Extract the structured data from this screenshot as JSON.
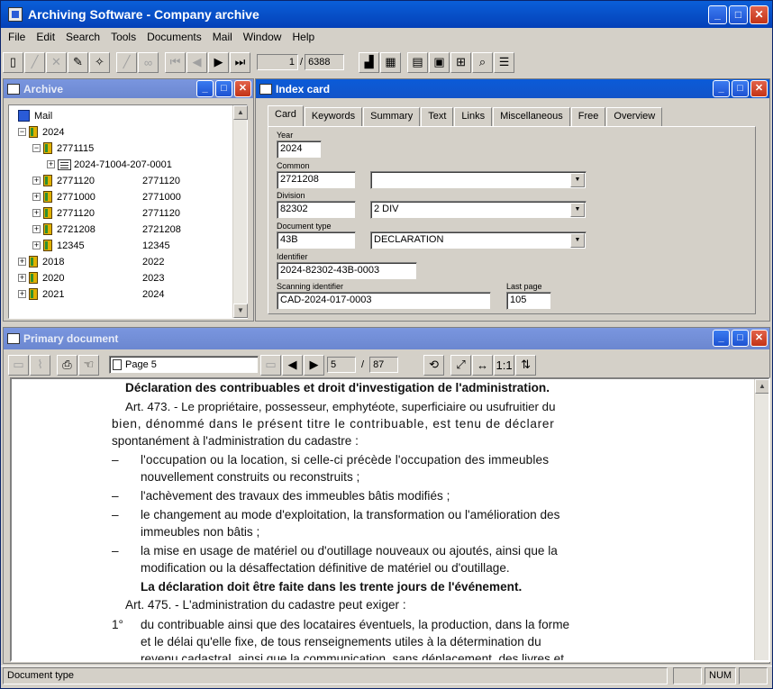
{
  "app": {
    "title": "Archiving Software - Company archive"
  },
  "menu": [
    "File",
    "Edit",
    "Search",
    "Tools",
    "Documents",
    "Mail",
    "Window",
    "Help"
  ],
  "toolbar": {
    "record": "1",
    "record_sep": "/",
    "total": "6388"
  },
  "archive": {
    "title": "Archive",
    "root": "Mail",
    "rows": [
      {
        "label": "2024",
        "col2": ""
      },
      {
        "label": "2771115",
        "col2": ""
      },
      {
        "label": "2024-71004-207-0001",
        "col2": ""
      },
      {
        "label": "2771120",
        "col2": "2771120"
      },
      {
        "label": "2771000",
        "col2": "2771000"
      },
      {
        "label": "2771120",
        "col2": "2771120"
      },
      {
        "label": "2721208",
        "col2": "2721208"
      },
      {
        "label": "12345",
        "col2": "12345"
      },
      {
        "label": "2018",
        "col2": "2022"
      },
      {
        "label": "2020",
        "col2": "2023"
      },
      {
        "label": "2021",
        "col2": "2024"
      }
    ]
  },
  "indexcard": {
    "title": "Index card",
    "tabs": [
      "Card",
      "Keywords",
      "Summary",
      "Text",
      "Links",
      "Miscellaneous",
      "Free",
      "Overview"
    ],
    "fields": {
      "year_label": "Year",
      "year": "2024",
      "common_label": "Common",
      "common": "2721208",
      "common_combo": "",
      "division_label": "Division",
      "division": "82302",
      "division_combo": "2 DIV",
      "doctype_label": "Document type",
      "doctype": "43B",
      "doctype_combo": "DECLARATION",
      "identifier_label": "Identifier",
      "identifier": "2024-82302-43B-0003",
      "scanning_label": "Scanning identifier",
      "scanning": "CAD-2024-017-0003",
      "lastpage_label": "Last page",
      "lastpage": "105"
    }
  },
  "primary": {
    "title": "Primary document",
    "page_select": "Page 5",
    "page": "5",
    "page_sep": "/",
    "pages": "87",
    "text": [
      "Déclaration des contribuables et droit d'investigation de l'administration.",
      "Art. 473.  -  Le propriétaire, possesseur, emphytéote, superficiaire ou usufruitier du",
      "bien, dénommé dans le présent titre le contribuable, est tenu de déclarer",
      "spontanément à l'administration du cadastre :",
      "–",
      "l'occupation ou la location, si celle-ci précède l'occupation des immeubles",
      "nouvellement construits ou reconstruits ;",
      "–",
      "l'achèvement des travaux des immeubles bâtis modifiés ;",
      "–",
      "le changement au mode d'exploitation, la transformation ou l'amélioration des",
      "immeubles non bâtis ;",
      "–",
      "la mise en usage de matériel ou d'outillage nouveaux ou ajoutés, ainsi que la",
      "modification ou la désaffectation définitive de matériel ou d'outillage.",
      "La déclaration doit être faite dans les trente jours de l'événement.",
      "Art. 475.  -  L'administration du cadastre peut exiger :",
      "1°",
      "du contribuable ainsi que des locataires éventuels, la production, dans la forme",
      "et le délai qu'elle fixe, de tous renseignements utiles à la détermination du",
      "revenu cadastral, ainsi que la communication, sans déplacement, des livres et"
    ]
  },
  "status": {
    "text": "Document type",
    "num": "NUM"
  }
}
